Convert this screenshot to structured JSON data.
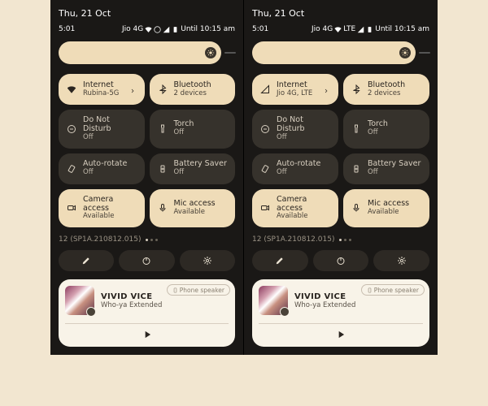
{
  "panels": [
    {
      "date": "Thu, 21 Oct",
      "clock": "5:01",
      "net": "Jio 4G",
      "until": "Until 10:15 am",
      "internet_sub": "Rubina-5G",
      "internet_icon": "wifi"
    },
    {
      "date": "Thu, 21 Oct",
      "clock": "5:01",
      "net": "Jio 4G",
      "lte": "LTE",
      "until": "Until 10:15 am",
      "internet_sub": "Jio 4G, LTE",
      "internet_icon": "signal"
    }
  ],
  "tiles": {
    "internet_label": "Internet",
    "bt_label": "Bluetooth",
    "bt_sub": "2 devices",
    "dnd_label": "Do Not Disturb",
    "dnd_sub": "Off",
    "torch_label": "Torch",
    "torch_sub": "Off",
    "rotate_label": "Auto-rotate",
    "rotate_sub": "Off",
    "battery_label": "Battery Saver",
    "battery_sub": "Off",
    "camera_label": "Camera access",
    "camera_sub": "Available",
    "mic_label": "Mic access",
    "mic_sub": "Available"
  },
  "build": "12 (SP1A.210812.015)",
  "media": {
    "title": "VIVID VICE",
    "artist": "Who-ya Extended",
    "output": "Phone speaker"
  }
}
